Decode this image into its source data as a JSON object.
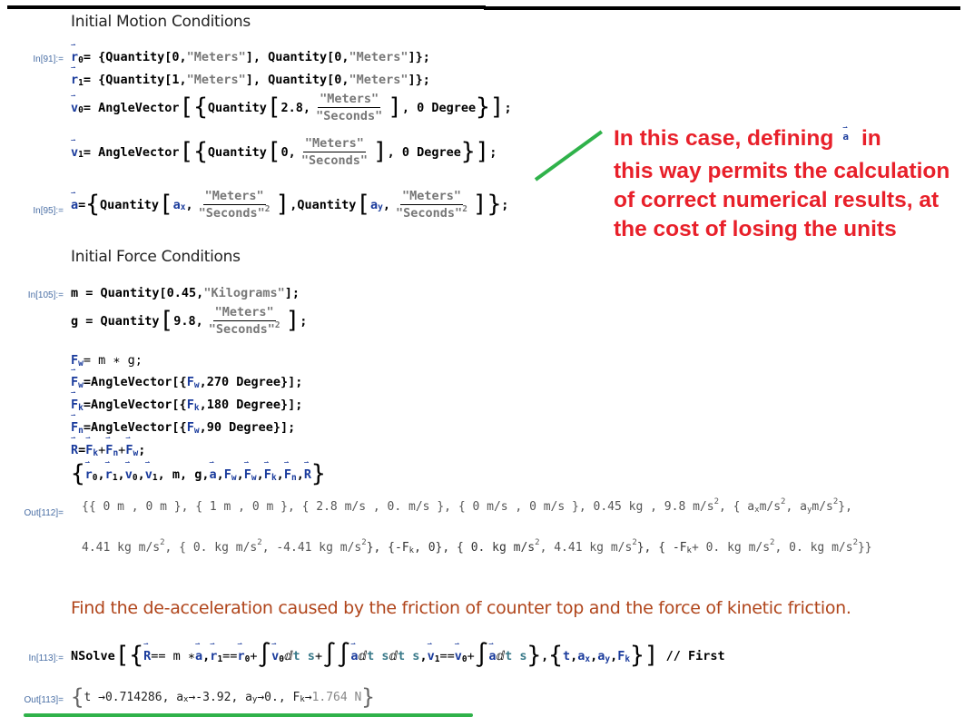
{
  "sections": {
    "motion_title": "Initial Motion Conditions",
    "force_title": "Initial Force Conditions",
    "find_title": "Find the de-acceleration caused by the friction of counter top and the force of kinetic friction."
  },
  "labels": {
    "in91": "In[91]:=",
    "in95": "In[95]:=",
    "in105": "In[105]:=",
    "out112": "Out[112]=",
    "in113": "In[113]:=",
    "out113": "Out[113]="
  },
  "code": {
    "r0": {
      "lhs": "r",
      "sub": "0",
      "rhs": " = {Quantity[0, ",
      "unit1": "\"Meters\"",
      "mid": "], Quantity[0, ",
      "unit2": "\"Meters\"",
      "end": "]};"
    },
    "r1": {
      "lhs": "r",
      "sub": "1",
      "rhs": " = {Quantity[1, ",
      "unit1": "\"Meters\"",
      "mid": "], Quantity[0, ",
      "unit2": "\"Meters\"",
      "end": "]};"
    },
    "v0": {
      "lhs": "v",
      "sub": "0",
      "pre": " = AngleVector",
      "q": "Quantity",
      "val": "2.8,",
      "num": "\"Meters\"",
      "den": "\"Seconds\"",
      "deg": ", 0 Degree"
    },
    "v1": {
      "lhs": "v",
      "sub": "1",
      "pre": " = AngleVector",
      "q": "Quantity",
      "val": "0,",
      "num": "\"Meters\"",
      "den": "\"Seconds\"",
      "deg": ", 0 Degree"
    },
    "a": {
      "lhs": "a",
      "pre": " = ",
      "q": "Quantity",
      "ax": "a",
      "axsub": "x",
      "ay": "a",
      "aysub": "y",
      "num": "\"Meters\"",
      "den": "\"Seconds\"",
      "sup": "2"
    },
    "m": {
      "text": "m = Quantity[0.45, ",
      "unit": "\"Kilograms\"",
      "end": "];"
    },
    "g": {
      "pre": "g = Quantity",
      "val": "9.8,",
      "num": "\"Meters\"",
      "den": "\"Seconds\"",
      "sup": "2"
    },
    "fw": "F",
    "fw_rest": " = m ∗ g;",
    "vec_fw": {
      "angle": "270 Degree"
    },
    "vec_fk": {
      "angle": "180 Degree"
    },
    "vec_fn": {
      "angle": "90 Degree"
    },
    "angle_vector": "AngleVector[{",
    "list_line": "{r0, r1, v0, v1, m, g, a, Fw, Fw, Fk, Fn, R}"
  },
  "output112": {
    "line1": [
      "{{ 0 m , 0 m }, { 1 m , 0 m }, { 2.8 m/s , 0. m/s }, { 0 m/s , 0 m/s }, 0.45 kg , 9.8 m/s",
      "2",
      " , { a",
      "x",
      " m/s",
      "2",
      " , a",
      "y",
      " m/s",
      "2",
      " },"
    ],
    "line2": [
      "4.41 kg m/s",
      "2",
      " , { 0. kg m/s",
      "2",
      " , -4.41 kg m/s",
      "2",
      " }, {-F",
      "k",
      ", 0}, { 0. kg m/s",
      "2",
      " , 4.41 kg m/s",
      "2",
      " }, { -F",
      "k",
      " + 0. kg m/s",
      "2",
      " , 0. kg m/s",
      "2",
      " }}"
    ]
  },
  "nsolve": {
    "fn": "NSolve",
    "postfix": "// First"
  },
  "output113": {
    "t": "0.714286",
    "ax": "-3.92",
    "ay": "0.",
    "fk": "1.764 N"
  },
  "annotation": {
    "line1a": "In this case, defining",
    "line1b": "in",
    "rest": "this way permits the calculation of correct numerical results, at the cost of losing the units",
    "symbol": "a"
  },
  "colors": {
    "annotation": "#e8202a",
    "highlight": "#2fb24a",
    "section_brown": "#b0451b",
    "symbol_blue": "#1a3b9c"
  }
}
